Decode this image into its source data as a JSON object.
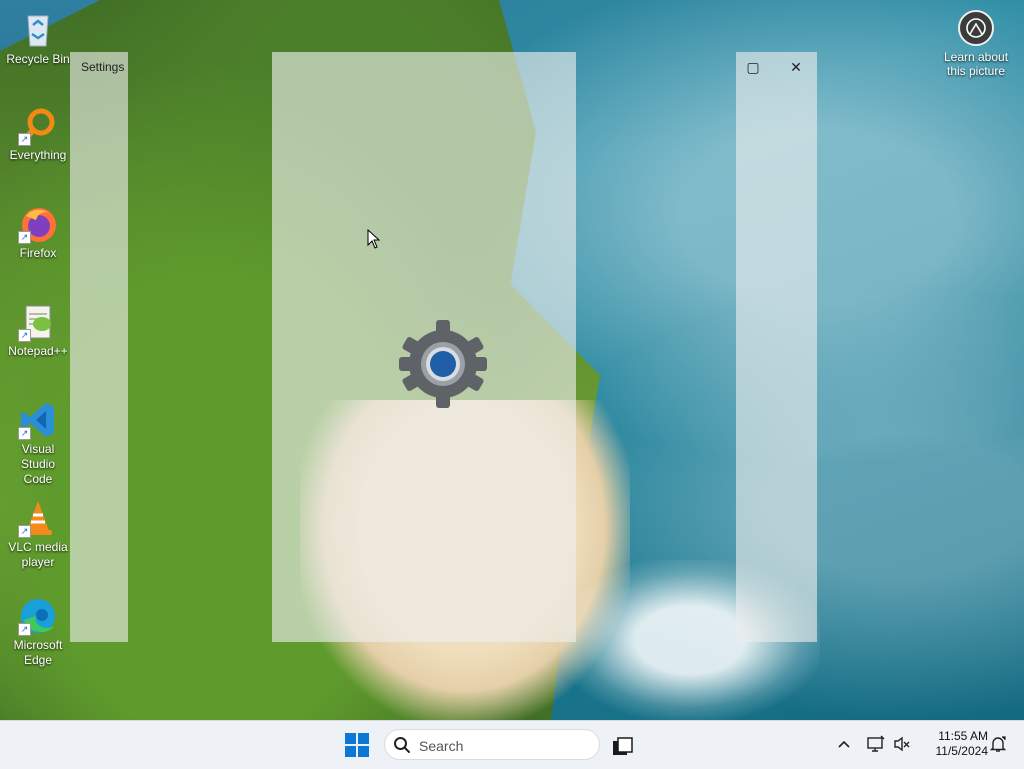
{
  "desktop": {
    "icons": [
      {
        "label": "Recycle Bin",
        "icon": "recycle-bin-icon"
      },
      {
        "label": "Everything",
        "icon": "everything-search-icon"
      },
      {
        "label": "Firefox",
        "icon": "firefox-icon"
      },
      {
        "label": "Notepad++",
        "icon": "notepad-plus-plus-icon"
      },
      {
        "label": "Visual Studio Code",
        "icon": "vscode-icon"
      },
      {
        "label": "VLC media player",
        "icon": "vlc-icon"
      },
      {
        "label": "Microsoft Edge",
        "icon": "edge-icon"
      }
    ],
    "learn_about_picture": "Learn about this picture"
  },
  "settings_window": {
    "title": "Settings",
    "maximize_glyph": "▢",
    "close_glyph": "✕",
    "splash_icon": "gear-icon"
  },
  "taskbar": {
    "search_placeholder": "Search",
    "tray_chevron": "^",
    "time": "11:55 AM",
    "date": "11/5/2024"
  },
  "colors": {
    "accent": "#0067c0",
    "taskbar_bg": "#eef1f5",
    "gear_gray": "#5f6368",
    "gear_blue": "#1f5fa8"
  }
}
